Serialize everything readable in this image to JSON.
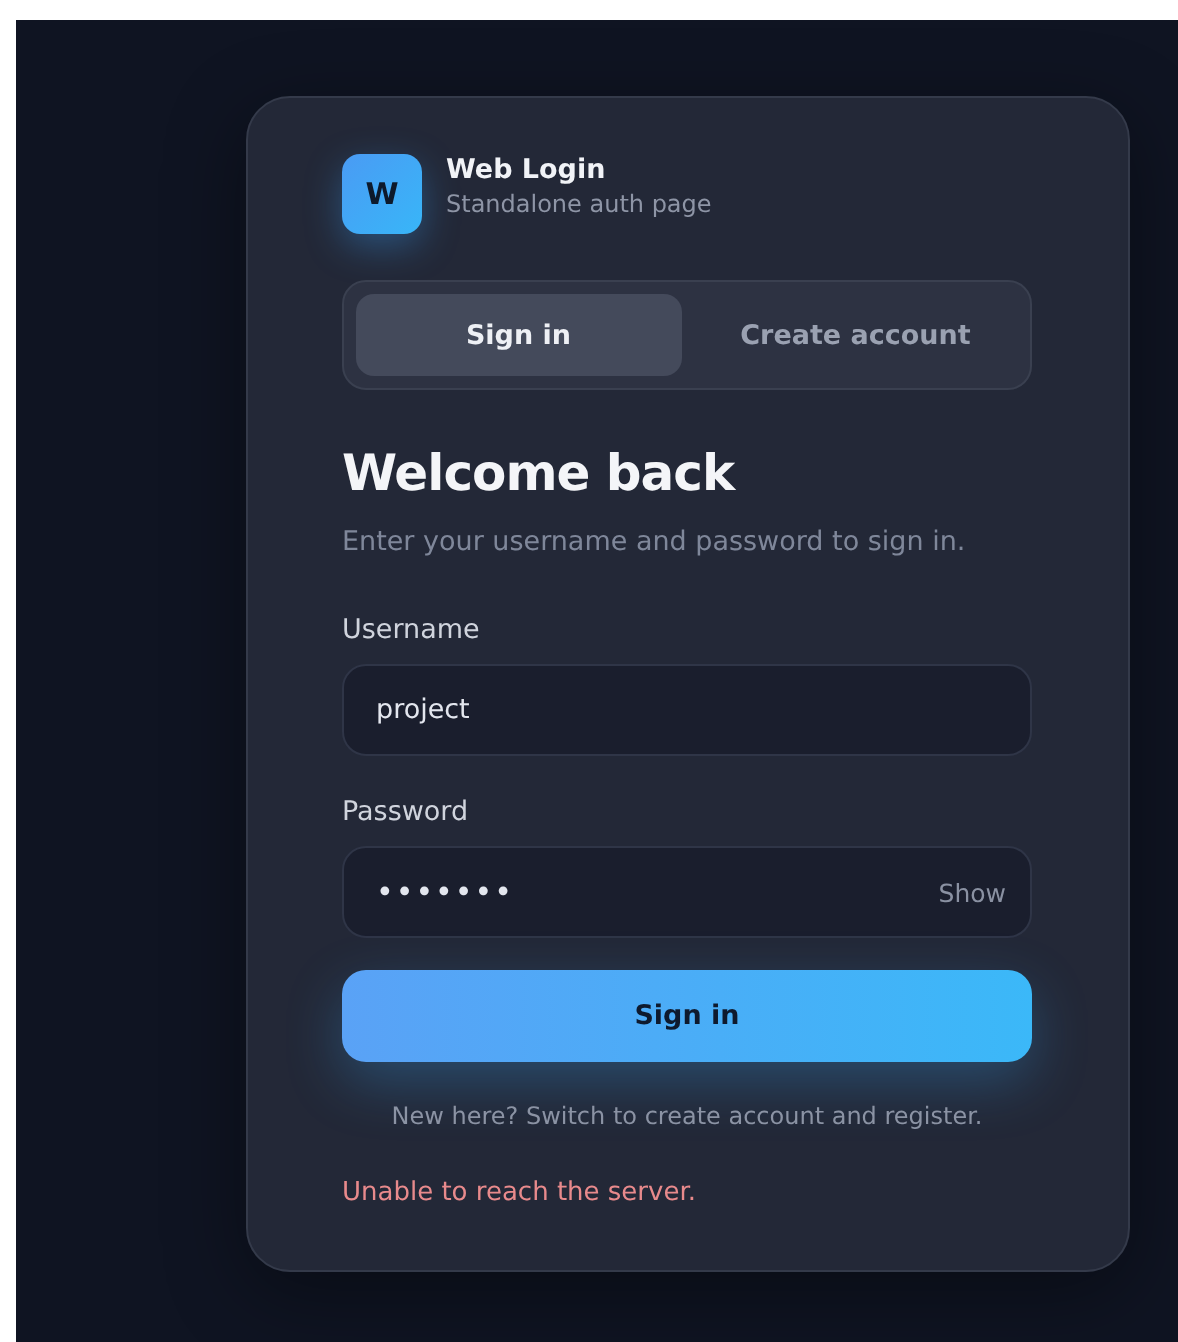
{
  "brand": {
    "logo": "W",
    "title": "Web Login",
    "subtitle": "Standalone auth page"
  },
  "tabs": [
    {
      "label": "Sign in",
      "selected": true
    },
    {
      "label": "Create account",
      "selected": false
    }
  ],
  "heading": "Welcome back",
  "intro": "Enter your username and password to sign in.",
  "fields": [
    {
      "label": "Username",
      "value": "project",
      "kind": "text"
    },
    {
      "label": "Password",
      "value": "•••••••",
      "kind": "password",
      "toggle": "Show"
    }
  ],
  "submit": "Sign in",
  "hint": "New here? Switch to create account and register.",
  "error": "Unable to reach the server."
}
